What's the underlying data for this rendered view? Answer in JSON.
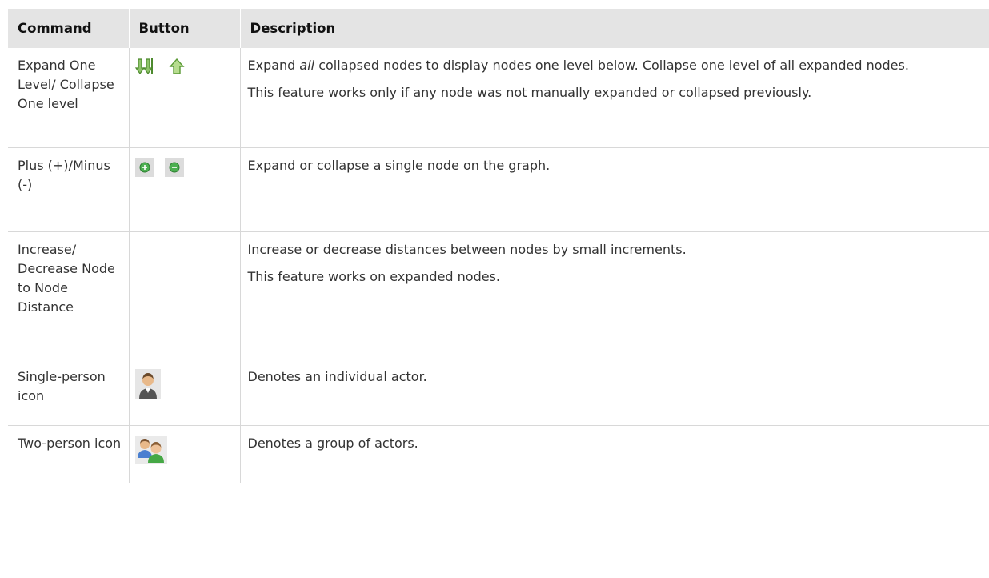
{
  "header": {
    "command": "Command",
    "button": "Button",
    "description": "Description"
  },
  "rows": [
    {
      "command": "Expand One Level/ Collapse One level",
      "buttons": [
        "expand-one-level-icon",
        "collapse-one-level-icon"
      ],
      "description": [
        {
          "before": "Expand ",
          "em": "all",
          "after": " collapsed nodes to display nodes one level below. Collapse one level of all expanded nodes."
        },
        {
          "text": "This feature works only if any node was not manually expanded or collapsed previously."
        }
      ]
    },
    {
      "command": "Plus (+)/Minus (-)",
      "buttons": [
        "plus-node-icon",
        "minus-node-icon"
      ],
      "description": [
        {
          "text": "Expand or collapse a single node on the graph."
        }
      ]
    },
    {
      "command": "Increase/ Decrease Node to Node Distance",
      "buttons": [],
      "description": [
        {
          "text": "Increase or decrease distances between nodes by small increments."
        },
        {
          "text": "This feature works on expanded nodes."
        }
      ]
    },
    {
      "command": "Single-person icon",
      "buttons": [
        "single-person-icon"
      ],
      "description": [
        {
          "text": "Denotes an individual actor."
        }
      ]
    },
    {
      "command": "Two-person icon",
      "buttons": [
        "two-person-icon"
      ],
      "description": [
        {
          "text": "Denotes a group of actors."
        }
      ]
    }
  ],
  "colors": {
    "header_bg": "#e4e4e4",
    "rule": "#d8d8d8",
    "arrow_green": "#6aa84f",
    "node_button_green": "#4caf50"
  }
}
